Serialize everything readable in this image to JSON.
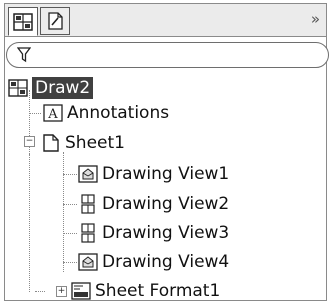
{
  "tabs": [
    {
      "icon": "feature-tree-icon",
      "active": true
    },
    {
      "icon": "property-manager-icon",
      "active": false
    }
  ],
  "chevron": "»",
  "filter": {
    "icon": "filter-icon",
    "value": ""
  },
  "tree": {
    "root": {
      "label": "Draw2",
      "icon": "drawing-icon"
    },
    "annotations": {
      "label": "Annotations",
      "icon": "annotation-icon"
    },
    "sheet": {
      "label": "Sheet1",
      "icon": "sheet-icon",
      "expanded": true
    },
    "views": [
      {
        "label": "Drawing View1",
        "icon": "drawing-view-icon"
      },
      {
        "label": "Drawing View2",
        "icon": "projected-view-icon"
      },
      {
        "label": "Drawing View3",
        "icon": "projected-view-icon"
      },
      {
        "label": "Drawing View4",
        "icon": "drawing-view-icon"
      }
    ],
    "sheet_format": {
      "label": "Sheet Format1",
      "icon": "sheet-format-icon",
      "expanded": false
    }
  }
}
